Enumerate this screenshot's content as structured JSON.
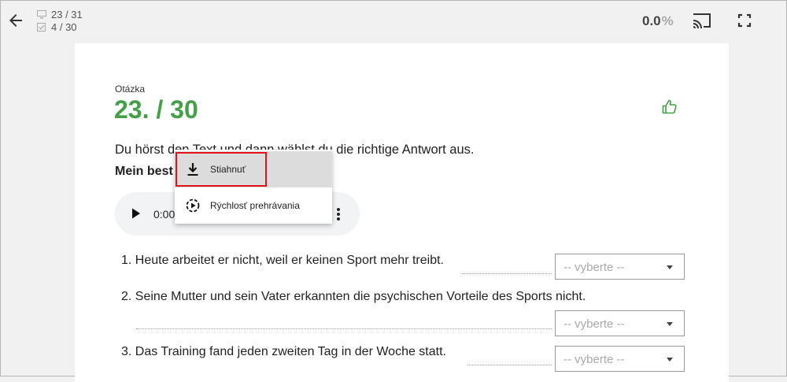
{
  "header": {
    "slides_counter": "23 / 31",
    "questions_counter": "4 / 30",
    "progress_value": "0.0",
    "progress_unit": "%"
  },
  "question": {
    "label": "Otázka",
    "number": "23. / 30",
    "instruction": "Du hörst den Text und dann wählst du die richtige Antwort aus.",
    "subtitle": "Mein best"
  },
  "audio": {
    "time": "0:00"
  },
  "context_menu": {
    "items": [
      {
        "label": "Stiahnuť",
        "icon": "download-icon"
      },
      {
        "label": "Rýchlosť prehrávania",
        "icon": "playback-speed-icon"
      }
    ]
  },
  "items": [
    {
      "text": "1. Heute arbeitet er nicht, weil er keinen Sport mehr treibt.",
      "select_placeholder": "-- vyberte --"
    },
    {
      "text": "2. Seine Mutter und sein Vater erkannten die psychischen Vorteile des Sports nicht.",
      "select_placeholder": "-- vyberte --"
    },
    {
      "text": "3. Das Training fand jeden zweiten Tag in der Woche statt.",
      "select_placeholder": "-- vyberte --"
    }
  ],
  "colors": {
    "accent_green": "#43a047",
    "highlight_red": "#e3131b"
  }
}
